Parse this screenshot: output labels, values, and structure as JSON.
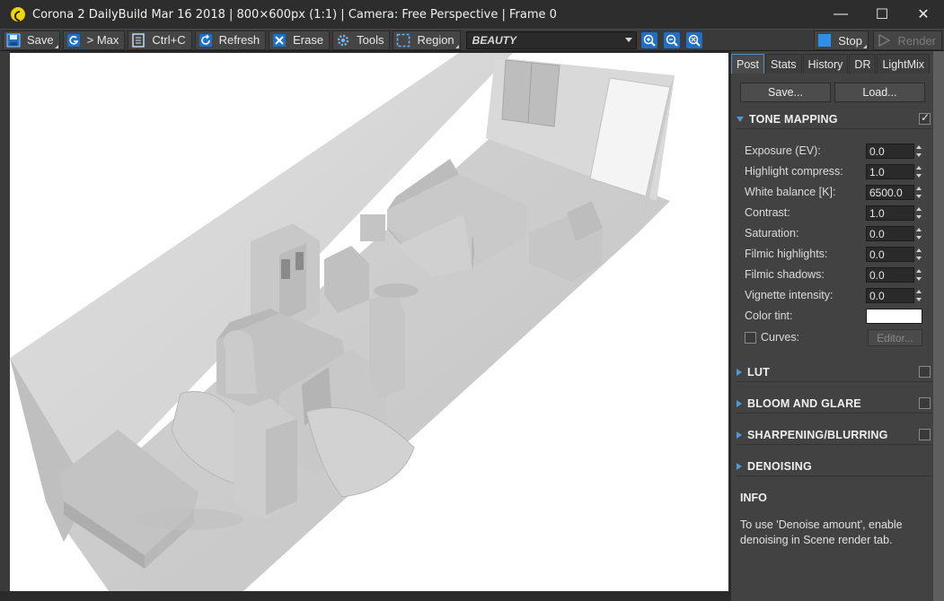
{
  "window": {
    "title": "Corona 2 DailyBuild Mar 16 2018 | 800×600px (1:1) | Camera: Free Perspective | Frame 0",
    "minimize": "—",
    "maximize": "☐",
    "close": "✕"
  },
  "toolbar": {
    "save": "Save",
    "max": "> Max",
    "copy": "Ctrl+C",
    "refresh": "Refresh",
    "erase": "Erase",
    "tools": "Tools",
    "region": "Region",
    "channel": "BEAUTY",
    "stop": "Stop",
    "render": "Render"
  },
  "tabs": [
    "Post",
    "Stats",
    "History",
    "DR",
    "LightMix"
  ],
  "panel": {
    "save_btn": "Save...",
    "load_btn": "Load...",
    "tone_mapping": "TONE MAPPING",
    "params": [
      {
        "label": "Exposure (EV):",
        "value": "0.0"
      },
      {
        "label": "Highlight compress:",
        "value": "1.0"
      },
      {
        "label": "White balance [K]:",
        "value": "6500.0"
      },
      {
        "label": "Contrast:",
        "value": "1.0"
      },
      {
        "label": "Saturation:",
        "value": "0.0"
      },
      {
        "label": "Filmic highlights:",
        "value": "0.0"
      },
      {
        "label": "Filmic shadows:",
        "value": "0.0"
      },
      {
        "label": "Vignette intensity:",
        "value": "0.0"
      }
    ],
    "color_tint": "Color tint:",
    "curves": "Curves:",
    "editor": "Editor...",
    "lut": "LUT",
    "bloom": "BLOOM AND GLARE",
    "sharpen": "SHARPENING/BLURRING",
    "denoise": "DENOISING",
    "info_title": "INFO",
    "info_text": "To use 'Denoise amount', enable denoising in Scene render tab."
  },
  "colors": {
    "accent": "#4a9ade",
    "app_icon": "#f2d400",
    "stop_icon": "#2f8fe6"
  }
}
